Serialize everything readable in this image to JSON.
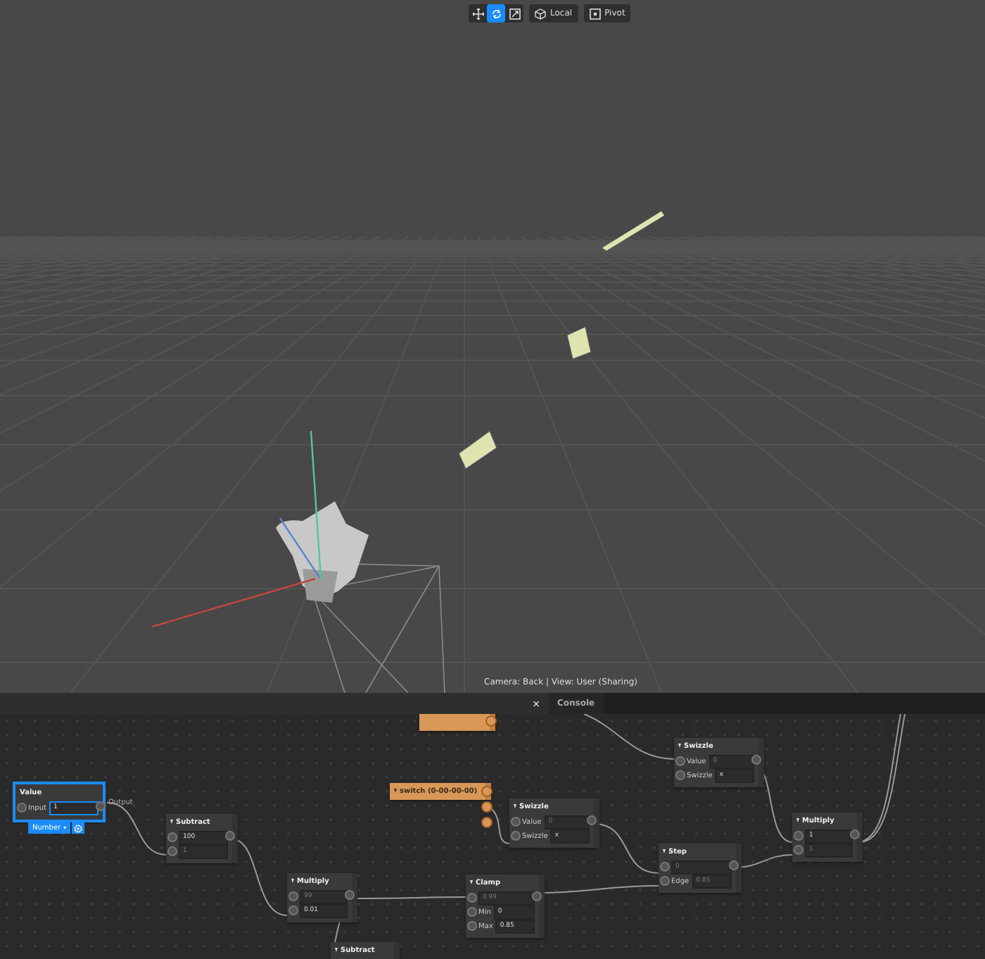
{
  "toolbar": {
    "tools": [
      {
        "kind": "move",
        "selected": false
      },
      {
        "kind": "rotate",
        "selected": true
      },
      {
        "kind": "scale",
        "selected": false
      }
    ],
    "buttons": [
      {
        "kind": "space",
        "label": "Local"
      },
      {
        "kind": "pivot",
        "label": "Pivot"
      }
    ]
  },
  "viewport": {
    "camera_label": "Camera: Back | View: User (Sharing)"
  },
  "panel": {
    "close": "×",
    "tabs": [
      {
        "label": "Console",
        "selected": false
      }
    ]
  },
  "graph": {
    "nodes": [
      {
        "kind": "switch"
      },
      {
        "kind": "math",
        "title": "Swizzle",
        "expanded": true,
        "rows": [
          {
            "label": "Value",
            "value": "0",
            "disabled": true
          },
          {
            "label": "Swizzle",
            "value": "x",
            "disabled": false
          }
        ]
      },
      {
        "kind": "value",
        "title": "Value",
        "selected": true,
        "output": "Output",
        "type": "Number",
        "rows": [
          {
            "label": "Input",
            "value": "1",
            "disabled": false
          }
        ]
      },
      {
        "kind": "switch",
        "title": "switch (0-00-00-00)",
        "expanded": true
      },
      {
        "kind": "math",
        "title": "Swizzle",
        "expanded": true,
        "rows": [
          {
            "label": "Value",
            "value": "0",
            "disabled": true
          },
          {
            "label": "Swizzle",
            "value": "x",
            "disabled": false
          }
        ]
      },
      {
        "kind": "math",
        "title": "Subtract",
        "expanded": true,
        "rows": [
          {
            "value": "100",
            "disabled": false
          },
          {
            "value": "1",
            "disabled": true
          }
        ]
      },
      {
        "kind": "math",
        "title": "Multiply",
        "expanded": true,
        "rows": [
          {
            "value": "1",
            "disabled": false
          },
          {
            "value": "1",
            "disabled": true
          }
        ]
      },
      {
        "kind": "math",
        "title": "Step",
        "expanded": true,
        "rows": [
          {
            "value": "0",
            "disabled": true
          },
          {
            "label": "Edge",
            "value": "0.85",
            "disabled": true
          }
        ]
      },
      {
        "kind": "math",
        "title": "Multiply",
        "expanded": true,
        "rows": [
          {
            "value": "99",
            "disabled": true
          },
          {
            "value": "0.01",
            "disabled": false
          }
        ]
      },
      {
        "kind": "math",
        "title": "Clamp",
        "expanded": true,
        "rows": [
          {
            "value": "0.99",
            "disabled": true
          },
          {
            "label": "Min",
            "value": "0",
            "disabled": false
          },
          {
            "label": "Max",
            "value": "0.85",
            "disabled": false
          }
        ]
      },
      {
        "kind": "math",
        "title": "Subtract",
        "expanded": true
      }
    ]
  }
}
